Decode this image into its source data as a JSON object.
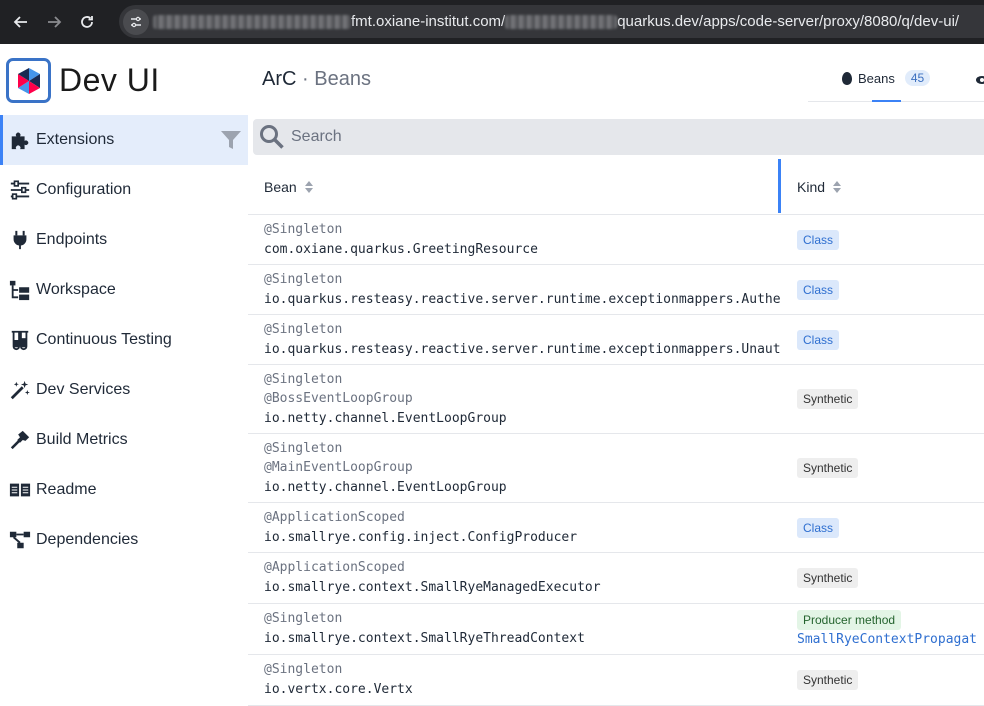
{
  "browser": {
    "url_host": "fmt.oxiane-institut.com/",
    "url_path": "quarkus.dev/apps/code-server/proxy/8080/q/dev-ui/"
  },
  "sidebar": {
    "brand_title": "Dev UI",
    "items": [
      {
        "label": "Extensions",
        "icon": "puzzle-icon",
        "active": true
      },
      {
        "label": "Configuration",
        "icon": "sliders-icon"
      },
      {
        "label": "Endpoints",
        "icon": "plug-icon"
      },
      {
        "label": "Workspace",
        "icon": "folder-tree-icon"
      },
      {
        "label": "Continuous Testing",
        "icon": "flask-icon"
      },
      {
        "label": "Dev Services",
        "icon": "magic-wand-icon"
      },
      {
        "label": "Build Metrics",
        "icon": "hammer-icon"
      },
      {
        "label": "Readme",
        "icon": "book-icon"
      },
      {
        "label": "Dependencies",
        "icon": "graph-icon"
      }
    ]
  },
  "header": {
    "title": "ArC",
    "separator": "·",
    "subtitle": "Beans",
    "tab_label": "Beans",
    "tab_count": "45"
  },
  "search": {
    "placeholder": "Search"
  },
  "table": {
    "columns": [
      "Bean",
      "Kind"
    ],
    "rows": [
      {
        "annotations": [
          "@Singleton"
        ],
        "class": "com.oxiane.quarkus.GreetingResource",
        "kind": "Class"
      },
      {
        "annotations": [
          "@Singleton"
        ],
        "class": "io.quarkus.resteasy.reactive.server.runtime.exceptionmappers.AuthenticationCompletionExceptionMapper",
        "kind": "Class"
      },
      {
        "annotations": [
          "@Singleton"
        ],
        "class": "io.quarkus.resteasy.reactive.server.runtime.exceptionmappers.UnauthorizedExceptionMapper",
        "kind": "Class"
      },
      {
        "annotations": [
          "@Singleton",
          "@BossEventLoopGroup"
        ],
        "class": "io.netty.channel.EventLoopGroup",
        "kind": "Synthetic"
      },
      {
        "annotations": [
          "@Singleton",
          "@MainEventLoopGroup"
        ],
        "class": "io.netty.channel.EventLoopGroup",
        "kind": "Synthetic"
      },
      {
        "annotations": [
          "@ApplicationScoped"
        ],
        "class": "io.smallrye.config.inject.ConfigProducer",
        "kind": "Class"
      },
      {
        "annotations": [
          "@ApplicationScoped"
        ],
        "class": "io.smallrye.context.SmallRyeManagedExecutor",
        "kind": "Synthetic"
      },
      {
        "annotations": [
          "@Singleton"
        ],
        "class": "io.smallrye.context.SmallRyeThreadContext",
        "kind": "Producer method",
        "producer": "SmallRyeContextPropagat"
      },
      {
        "annotations": [
          "@Singleton"
        ],
        "class": "io.vertx.core.Vertx",
        "kind": "Synthetic"
      }
    ]
  },
  "colors": {
    "accent": "#3b82f6",
    "sidebar_active": "#e4edfb"
  }
}
